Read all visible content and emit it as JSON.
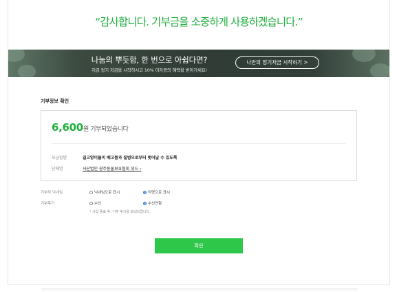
{
  "header": {
    "thanks": "“감사합니다. 기부금을 소중하게 사용하겠습니다.”"
  },
  "banner": {
    "title": "나눔의 뿌듯함, 한 번으로 아쉽다면?",
    "subtitle": "지금 정기 저금을 시작하시고 10% 이자콩의 혜택을 받아가세요!",
    "button": "나만의 정기저금 시작하기 >"
  },
  "donation": {
    "section_title": "기부정보 확인",
    "amount": "6,600",
    "amount_suffix": "원 기부되었습니다",
    "campaign_label": "모금함명",
    "campaign_value": "길고양이들이 배고픔과 질병으로부터 벗어날 수 있도록",
    "org_label": "단체명",
    "org_value": "사단법인 광주동물보호협회 위드 ›"
  },
  "options": {
    "nickname_label": "기부자 닉네임",
    "nickname_opt1": "닉네임으로 표시",
    "nickname_opt2": "익명으로 표시",
    "review_label": "기부후기",
    "review_opt1": "수신",
    "review_opt2": "수신안함",
    "note": "* 사업 종료 후, 기부 후기를 보내드립니다."
  },
  "actions": {
    "confirm": "확인"
  }
}
